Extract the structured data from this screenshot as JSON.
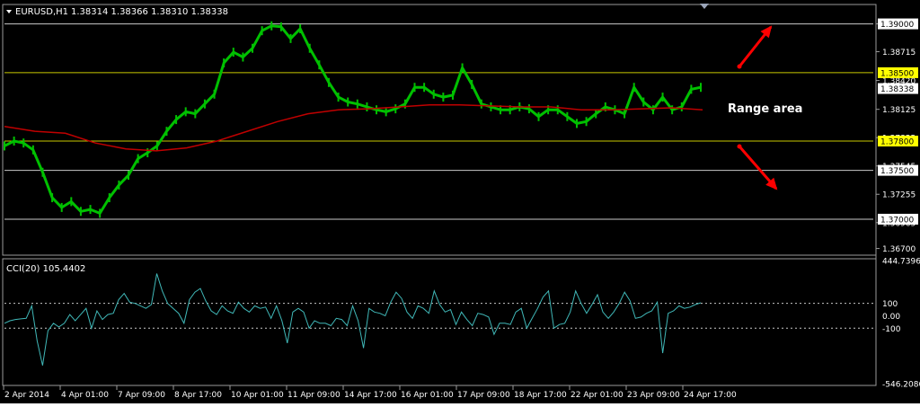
{
  "header": {
    "symbol": "EURUSD,H1",
    "ohlc": "1.38314 1.38366 1.38310 1.38338"
  },
  "annotation": "Range area",
  "colors": {
    "background": "#000000",
    "candles": "#00c000",
    "moving_average": "#c00000",
    "resistance": "#c8c800",
    "cci": "#40b8b8",
    "grid": "#c8c8c8",
    "arrow": "#ff0000"
  },
  "chart_data": [
    {
      "type": "line",
      "title": "EURUSD,H1",
      "ylim": [
        1.3665,
        1.3918
      ],
      "y_ticks": [
        "1.39000",
        "1.38715",
        "1.38420",
        "1.38125",
        "1.37835",
        "1.37545",
        "1.37255",
        "1.36965",
        "1.36700"
      ],
      "horizontal_lines": [
        {
          "value": 1.39,
          "label": "1.39000",
          "color": "#c8c8c8"
        },
        {
          "value": 1.385,
          "label": "1.38500",
          "color": "#c8c800"
        },
        {
          "value": 1.378,
          "label": "1.37800",
          "color": "#c8c800"
        },
        {
          "value": 1.375,
          "label": "1.37500",
          "color": "#c8c8c8"
        },
        {
          "value": 1.37,
          "label": "1.37000",
          "color": "#c8c8c8"
        }
      ],
      "current_price": "1.38338",
      "x_ticks": [
        "2 Apr 2014",
        "4 Apr 01:00",
        "7 Apr 09:00",
        "8 Apr 17:00",
        "10 Apr 01:00",
        "11 Apr 09:00",
        "14 Apr 17:00",
        "16 Apr 01:00",
        "17 Apr 09:00",
        "18 Apr 17:00",
        "22 Apr 01:00",
        "23 Apr 09:00",
        "24 Apr 17:00"
      ],
      "series": [
        {
          "values": [
            1.3775,
            1.378,
            1.3778,
            1.3771,
            1.3748,
            1.3722,
            1.3712,
            1.3718,
            1.3708,
            1.371,
            1.3706,
            1.3722,
            1.3735,
            1.3745,
            1.3762,
            1.3768,
            1.3775,
            1.379,
            1.3802,
            1.381,
            1.3808,
            1.3818,
            1.3828,
            1.386,
            1.3871,
            1.3866,
            1.3875,
            1.3893,
            1.3898,
            1.3897,
            1.3885,
            1.3895,
            1.3875,
            1.3858,
            1.384,
            1.3825,
            1.382,
            1.3818,
            1.3815,
            1.3812,
            1.381,
            1.3813,
            1.3818,
            1.3835,
            1.3835,
            1.3828,
            1.3825,
            1.3827,
            1.3855,
            1.3838,
            1.3818,
            1.3815,
            1.3812,
            1.3812,
            1.3815,
            1.3813,
            1.3805,
            1.3812,
            1.3812,
            1.3805,
            1.3798,
            1.38,
            1.3808,
            1.3815,
            1.3812,
            1.3808,
            1.3835,
            1.382,
            1.3812,
            1.3825,
            1.3812,
            1.3815,
            1.3833,
            1.3835
          ]
        },
        {
          "values": [
            1.3795,
            1.379,
            1.3788,
            1.3778,
            1.3772,
            1.377,
            1.3773,
            1.378,
            1.379,
            1.38,
            1.3808,
            1.3812,
            1.3813,
            1.3815,
            1.3817,
            1.3817,
            1.3816,
            1.3815,
            1.3815,
            1.3812,
            1.3812,
            1.3813,
            1.3814,
            1.3812
          ]
        }
      ]
    },
    {
      "type": "line",
      "title": "CCI(20) 105.4402",
      "ylim": [
        -546.2086,
        444.7396
      ],
      "y_ticks": [
        "444.7396",
        "100",
        "0.00",
        "-100",
        "-546.2086"
      ],
      "dashed_levels": [
        100,
        -100
      ],
      "series": [
        {
          "name": "CCI(20)",
          "values": [
            -60,
            -40,
            -30,
            -25,
            -20,
            80,
            -200,
            -400,
            -120,
            -60,
            -90,
            -60,
            10,
            -40,
            10,
            60,
            -100,
            40,
            -30,
            10,
            20,
            130,
            180,
            110,
            100,
            80,
            60,
            90,
            340,
            200,
            100,
            60,
            20,
            -60,
            130,
            190,
            220,
            120,
            40,
            10,
            80,
            40,
            20,
            110,
            60,
            30,
            80,
            60,
            70,
            -20,
            80,
            -40,
            -220,
            30,
            60,
            30,
            -100,
            -40,
            -60,
            -60,
            -80,
            -20,
            -30,
            -80,
            80,
            -40,
            -260,
            60,
            30,
            20,
            0,
            110,
            190,
            140,
            30,
            -20,
            80,
            60,
            20,
            200,
            90,
            30,
            50,
            -70,
            30,
            -30,
            -80,
            20,
            10,
            -10,
            -150,
            -60,
            -60,
            -70,
            30,
            60,
            -100,
            -20,
            60,
            150,
            200,
            -100,
            -70,
            -60,
            30,
            200,
            100,
            20,
            90,
            170,
            30,
            -20,
            30,
            100,
            190,
            120,
            -20,
            -10,
            20,
            40,
            110,
            -300,
            20,
            40,
            80,
            60,
            70,
            90,
            105
          ]
        }
      ]
    }
  ]
}
